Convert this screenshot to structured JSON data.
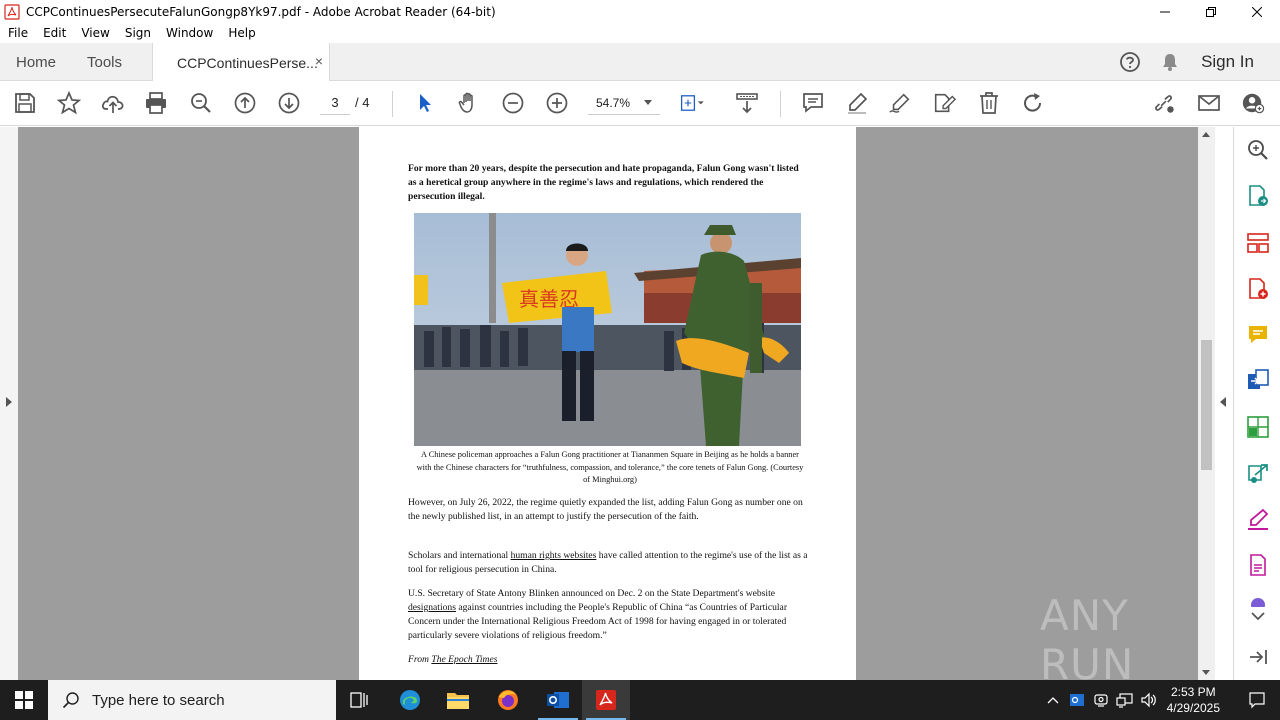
{
  "window": {
    "title": "CCPContinuesPersecuteFalunGongp8Yk97.pdf - Adobe Acrobat Reader (64-bit)"
  },
  "menu": [
    "File",
    "Edit",
    "View",
    "Sign",
    "Window",
    "Help"
  ],
  "tabs": {
    "home": "Home",
    "tools": "Tools",
    "document": "CCPContinuesPerse...",
    "close": "×",
    "sign_in": "Sign In"
  },
  "toolbar": {
    "current_page": "3",
    "total_pages": "/ 4",
    "zoom": "54.7%"
  },
  "document": {
    "para1": "For more than 20 years, despite the persecution and hate propaganda, Falun Gong wasn't listed as a heretical group anywhere in the regime's laws and regulations, which rendered the persecution illegal.",
    "banner_chars": "真善忍",
    "caption": "A Chinese policeman approaches a Falun Gong practitioner at Tiananmen Square in Beijing as he holds a banner with the Chinese characters for “truthfulness, compassion, and tolerance,” the core tenets of Falun Gong. (Courtesy of Minghui.org)",
    "para2": "However, on July 26, 2022, the regime quietly expanded the list, adding Falun Gong as number one on the newly published list, in an attempt to justify the persecution of the faith.",
    "para3_before": "Scholars and international ",
    "para3_link": "human rights websites",
    "para3_after": " have called attention to the regime's use of the list as a tool for religious persecution in China.",
    "para4_before": "U.S. Secretary of State Antony Blinken announced on Dec. 2 on the State Department's website ",
    "para4_link": "designations",
    "para4_after": " against countries including the People's Republic of China “as Countries of Particular Concern under the International Religious Freedom Act of 1998 for having engaged in or tolerated particularly severe violations of religious freedom.”",
    "from_label": "From ",
    "from_source": "The Epoch Times"
  },
  "watermark": "ANY RUN",
  "taskbar": {
    "search_placeholder": "Type here to search",
    "time": "2:53 PM",
    "date": "4/29/2025"
  },
  "colors": {
    "acrobat_red": "#d7261b",
    "icon_gray": "#555555",
    "right_tool_colors": [
      "#4a4a4a",
      "#1b8f84",
      "#d7261b",
      "#d7261b",
      "#e8b400",
      "#1f5bb5",
      "#2e9e3e",
      "#1b8f84",
      "#c2189c",
      "#c2189c",
      "#7b5cd6"
    ]
  }
}
